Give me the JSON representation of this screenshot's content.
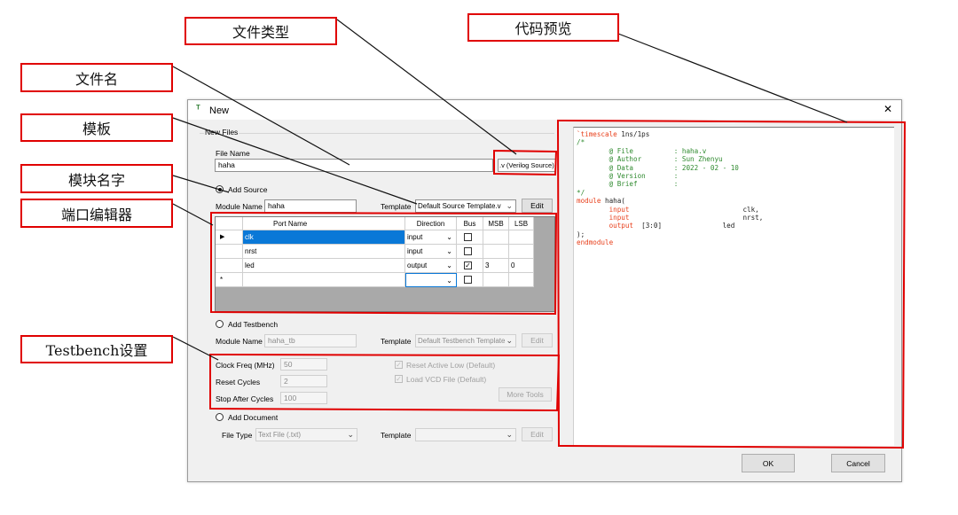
{
  "annotations": {
    "file_type": "文件类型",
    "code_preview": "代码预览",
    "file_name": "文件名",
    "template": "模板",
    "module_name": "模块名字",
    "port_editor": "端口编辑器",
    "testbench_settings": "Testbench设置"
  },
  "dialog": {
    "title": "New",
    "close_glyph": "✕",
    "group_label": "New Files",
    "file_name_label": "File Name",
    "file_name_value": "haha",
    "file_ext": ".v (Verilog Source)",
    "add_source_label": "Add Source",
    "module_name_label": "Module Name",
    "module_name_value": "haha",
    "template_label": "Template",
    "template_value": "Default Source Template.v",
    "edit_label": "Edit",
    "ports": {
      "headers": [
        "Port Name",
        "Direction",
        "Bus",
        "MSB",
        "LSB"
      ],
      "rows": [
        {
          "marker": "▶",
          "name": "clk",
          "direction": "input",
          "bus": false,
          "msb": "",
          "lsb": ""
        },
        {
          "marker": "",
          "name": "nrst",
          "direction": "input",
          "bus": false,
          "msb": "",
          "lsb": ""
        },
        {
          "marker": "",
          "name": "led",
          "direction": "output",
          "bus": true,
          "msb": "3",
          "lsb": "0"
        },
        {
          "marker": "*",
          "name": "",
          "direction": "",
          "bus": false,
          "msb": "",
          "lsb": ""
        }
      ]
    },
    "add_testbench_label": "Add Testbench",
    "tb_module_name_label": "Module Name",
    "tb_module_name_value": "haha_tb",
    "tb_template_label": "Template",
    "tb_template_value": "Default Testbench Template",
    "tb_edit_label": "Edit",
    "clock_label": "Clock Freq (MHz)",
    "clock_value": "50",
    "reset_cycles_label": "Reset Cycles",
    "reset_cycles_value": "2",
    "stop_label": "Stop After Cycles",
    "stop_value": "100",
    "reset_active_low": "Reset Active Low (Default)",
    "load_vcd": "Load VCD File (Default)",
    "more_tools": "More Tools",
    "add_document_label": "Add Document",
    "file_type_label": "File Type",
    "file_type_value": "Text File (.txt)",
    "doc_template_label": "Template",
    "doc_template_value": "",
    "doc_edit_label": "Edit",
    "ok_label": "OK",
    "cancel_label": "Cancel",
    "check_glyph": "✓",
    "chevron_glyph": "⌄"
  },
  "code_preview": {
    "l01": "`timescale",
    "l01b": " 1ns/1ps",
    "l02": "/*",
    "l03": "        @ File          : haha.v",
    "l04": "        @ Author        : Sun Zhenyu",
    "l05": "        @ Data          : 2022 - 02 - 10",
    "l06": "        @ Version       :",
    "l07": "        @ Brief         :",
    "l08": "",
    "l09": "*/",
    "l10a": "module",
    "l10b": " haha(",
    "l11a": "        input",
    "l11b": "                            clk,",
    "l12a": "        input",
    "l12b": "                            nrst,",
    "l13a": "        output",
    "l13b": "  [3:0]               led",
    "l14": "",
    "l15": ");",
    "l16": "",
    "l17": "endmodule"
  }
}
